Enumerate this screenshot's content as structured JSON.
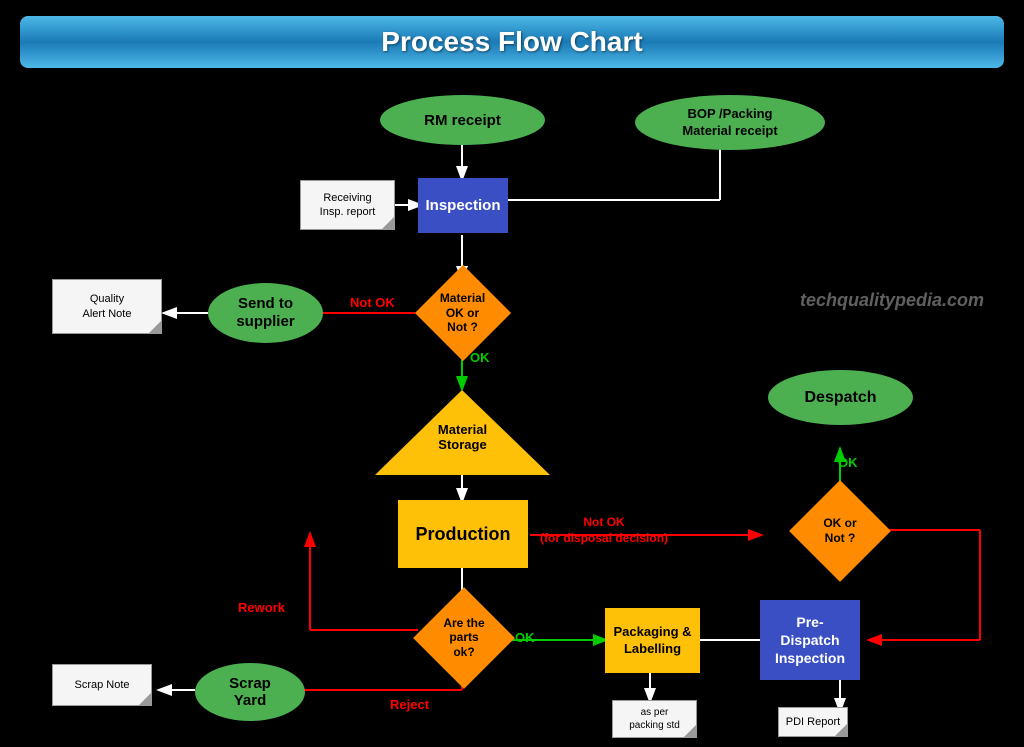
{
  "header": {
    "title": "Process Flow Chart"
  },
  "watermark": "techqualitypedia.com",
  "nodes": {
    "rm_receipt": "RM receipt",
    "bop_receipt": "BOP /Packing\nMaterial receipt",
    "receiving_report": "Receiving\nInsp. report",
    "inspection": "Inspection",
    "material_ok": "Material\nOK or\nNot ?",
    "send_to_supplier": "Send to\nsupplier",
    "quality_alert": "Quality\nAlert Note",
    "material_storage": "Material\nStorage",
    "production": "Production",
    "despatch": "Despatch",
    "ok_or_not": "OK or\nNot ?",
    "are_parts_ok": "Are the\nparts\nok?",
    "packaging": "Packaging &\nLabelling",
    "pre_dispatch": "Pre-\nDispatch\nInspection",
    "scrap_yard": "Scrap\nYard",
    "scrap_note": "Scrap Note",
    "pdi_report": "PDI Report",
    "as_per_packing": "as per\npacking std"
  },
  "labels": {
    "not_ok_1": "Not OK",
    "ok_1": "OK",
    "rework": "Rework",
    "ok_2": "OK",
    "reject": "Reject",
    "not_ok_disposal": "Not OK\n(for disposal decision)",
    "ok_despatch": "OK"
  }
}
